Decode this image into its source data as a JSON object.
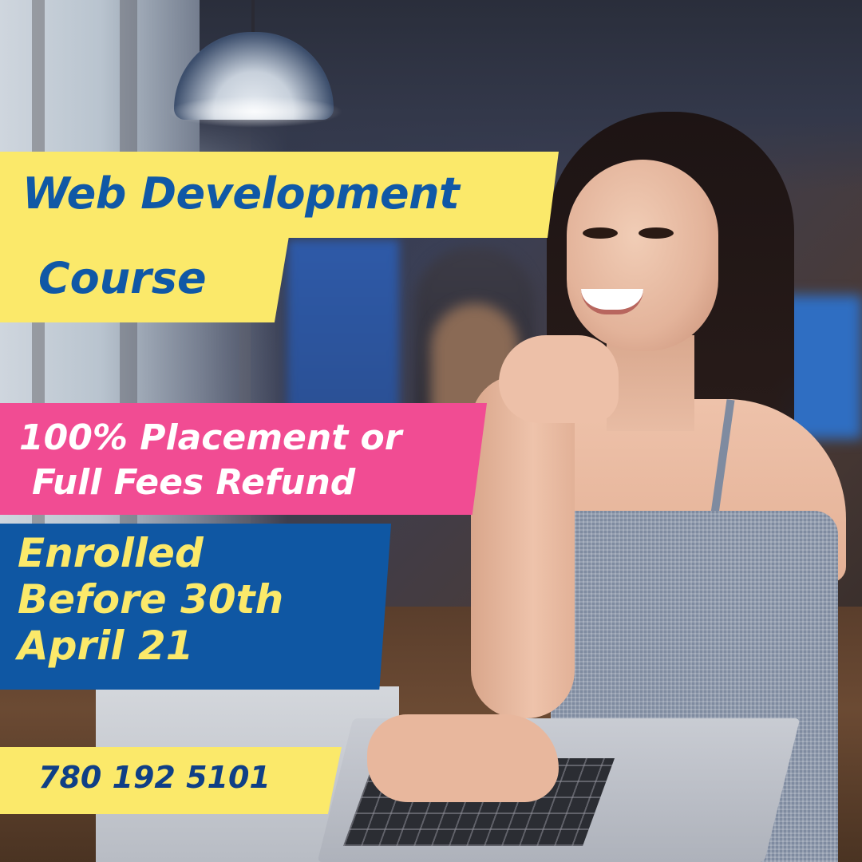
{
  "poster": {
    "title_line1": "Web Development",
    "title_line2": "Course",
    "placement_line1": "100% Placement or",
    "placement_line2": "Full Fees Refund",
    "enroll_line1": "Enrolled",
    "enroll_line2": "Before 30th",
    "enroll_line3": "April 21",
    "phone": "780 192 5101"
  },
  "colors": {
    "yellow": "#fbe96a",
    "blue": "#0f57a3",
    "pink": "#f14c93",
    "white": "#ffffff"
  }
}
